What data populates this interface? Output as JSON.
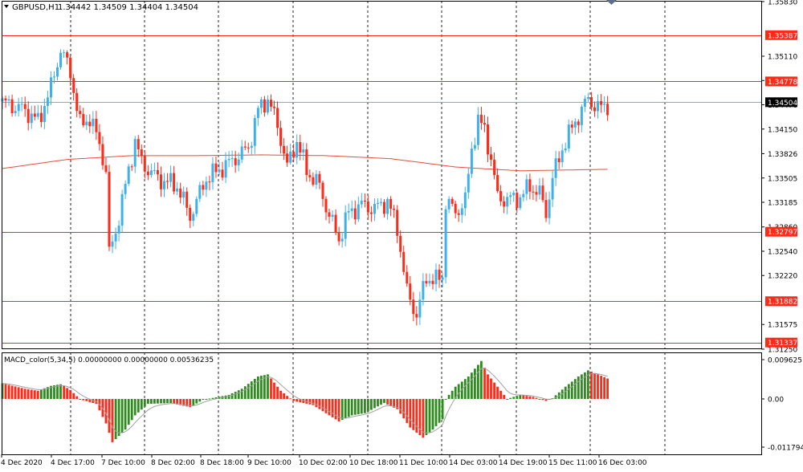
{
  "header": {
    "symbol": "GBPUSD,H1",
    "ohlc": "1.34442 1.34509 1.34404 1.34504"
  },
  "macd": {
    "label": "MACD_color(5,34,5) 0.00000000 0.00000000 0.00536235",
    "axis_labels": [
      "0.0096251",
      "0.00",
      "-0.0117947"
    ]
  },
  "colors": {
    "bull": "#3eb1ed",
    "bear": "#ff2a18",
    "hist_up": "#2e8b1e",
    "hist_down": "#ff2a18",
    "level": "#ff2a18",
    "ma": "#e74c3c",
    "bid": "#8fa7c8",
    "grid": "#222222"
  },
  "chart_data": {
    "type": "candlestick",
    "symbol": "GBPUSD",
    "timeframe": "H1",
    "ylim": [
      1.3126,
      1.3584
    ],
    "price_ticks": [
      "1.35830",
      "1.35110",
      "1.34790",
      "1.34470",
      "1.34150",
      "1.33826",
      "1.33505",
      "1.33185",
      "1.32860",
      "1.32540",
      "1.32220",
      "1.31575",
      "1.31250"
    ],
    "x_labels": [
      "4 Dec 2020",
      "4 Dec 17:00",
      "7 Dec 10:00",
      "8 Dec 02:00",
      "8 Dec 18:00",
      "9 Dec 10:00",
      "10 Dec 02:00",
      "10 Dec 18:00",
      "11 Dec 10:00",
      "14 Dec 03:00",
      "14 Dec 19:00",
      "15 Dec 11:00",
      "16 Dec 03:00"
    ],
    "levels": [
      "1.35387",
      "1.34778",
      "1.32797",
      "1.31882",
      "1.31337"
    ],
    "current_price": "1.34504",
    "anchors": [
      [
        0,
        1.345
      ],
      [
        7,
        1.344
      ],
      [
        11,
        1.3425
      ],
      [
        15,
        1.347
      ],
      [
        18,
        1.352
      ],
      [
        21,
        1.349
      ],
      [
        24,
        1.342
      ],
      [
        27,
        1.343
      ],
      [
        30,
        1.3395
      ],
      [
        32,
        1.336
      ],
      [
        33,
        1.325
      ],
      [
        35,
        1.328
      ],
      [
        39,
        1.336
      ],
      [
        41,
        1.34
      ],
      [
        43,
        1.337
      ],
      [
        48,
        1.335
      ],
      [
        54,
        1.334
      ],
      [
        58,
        1.33
      ],
      [
        63,
        1.335
      ],
      [
        70,
        1.337
      ],
      [
        76,
        1.339
      ],
      [
        79,
        1.344
      ],
      [
        82,
        1.3455
      ],
      [
        85,
        1.342
      ],
      [
        88,
        1.3365
      ],
      [
        91,
        1.34
      ],
      [
        94,
        1.336
      ],
      [
        98,
        1.334
      ],
      [
        101,
        1.33
      ],
      [
        104,
        1.327
      ],
      [
        107,
        1.3305
      ],
      [
        111,
        1.3315
      ],
      [
        115,
        1.331
      ],
      [
        119,
        1.332
      ],
      [
        122,
        1.3285
      ],
      [
        125,
        1.32
      ],
      [
        128,
        1.317
      ],
      [
        131,
        1.322
      ],
      [
        134,
        1.3215
      ],
      [
        136,
        1.3222
      ],
      [
        137,
        1.332
      ],
      [
        140,
        1.3305
      ],
      [
        143,
        1.332
      ],
      [
        145,
        1.339
      ],
      [
        147,
        1.3425
      ],
      [
        149,
        1.3415
      ],
      [
        151,
        1.3375
      ],
      [
        153,
        1.3325
      ],
      [
        156,
        1.3322
      ],
      [
        160,
        1.3325
      ],
      [
        163,
        1.334
      ],
      [
        166,
        1.333
      ],
      [
        168,
        1.3305
      ],
      [
        170,
        1.335
      ],
      [
        173,
        1.339
      ],
      [
        177,
        1.3425
      ],
      [
        181,
        1.3455
      ],
      [
        184,
        1.3442
      ],
      [
        187,
        1.3448
      ]
    ],
    "ma_anchors": [
      [
        0,
        1.3363
      ],
      [
        20,
        1.3375
      ],
      [
        40,
        1.338
      ],
      [
        60,
        1.338
      ],
      [
        80,
        1.3381
      ],
      [
        100,
        1.338
      ],
      [
        120,
        1.3376
      ],
      [
        140,
        1.3365
      ],
      [
        160,
        1.336
      ],
      [
        187,
        1.3362
      ]
    ],
    "macd_ylim": [
      -0.0117947,
      0.0096251
    ],
    "macd_anchors": [
      [
        0,
        0.0038
      ],
      [
        7,
        0.0025
      ],
      [
        11,
        0.002
      ],
      [
        15,
        0.0032
      ],
      [
        18,
        0.0036
      ],
      [
        21,
        0.0022
      ],
      [
        24,
        -0.0001
      ],
      [
        29,
        -0.0012
      ],
      [
        32,
        -0.006
      ],
      [
        34,
        -0.0106
      ],
      [
        38,
        -0.0075
      ],
      [
        41,
        -0.004
      ],
      [
        45,
        -0.0012
      ],
      [
        52,
        -0.001
      ],
      [
        58,
        -0.002
      ],
      [
        62,
        -0.0002
      ],
      [
        70,
        0.001
      ],
      [
        74,
        0.0025
      ],
      [
        79,
        0.0055
      ],
      [
        82,
        0.006
      ],
      [
        86,
        0.002
      ],
      [
        90,
        -0.0005
      ],
      [
        96,
        -0.0015
      ],
      [
        100,
        -0.0035
      ],
      [
        104,
        -0.0055
      ],
      [
        108,
        -0.004
      ],
      [
        112,
        -0.0035
      ],
      [
        118,
        -0.001
      ],
      [
        122,
        -0.0025
      ],
      [
        126,
        -0.007
      ],
      [
        130,
        -0.0095
      ],
      [
        133,
        -0.0075
      ],
      [
        136,
        -0.005
      ],
      [
        137,
        0.0
      ],
      [
        140,
        0.003
      ],
      [
        144,
        0.0055
      ],
      [
        148,
        0.0093
      ],
      [
        150,
        0.006
      ],
      [
        154,
        0.002
      ],
      [
        156,
        0.0
      ],
      [
        160,
        0.001
      ],
      [
        164,
        0.0005
      ],
      [
        168,
        -0.0005
      ],
      [
        170,
        0.0002
      ],
      [
        174,
        0.003
      ],
      [
        178,
        0.0055
      ],
      [
        181,
        0.007
      ],
      [
        184,
        0.006
      ],
      [
        187,
        0.005
      ]
    ]
  }
}
